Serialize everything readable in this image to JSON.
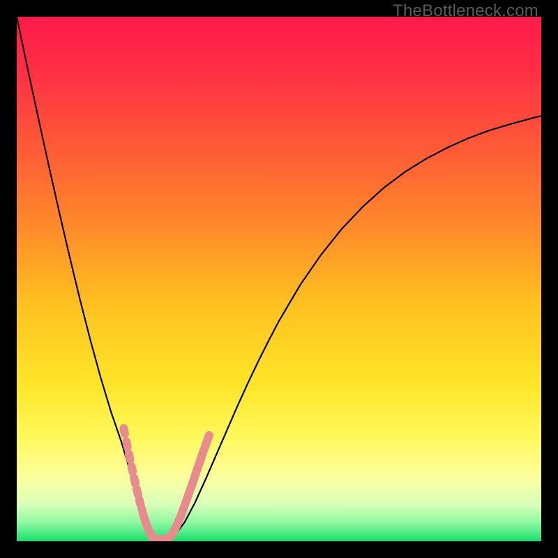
{
  "watermark": "TheBottleneck.com",
  "colors": {
    "gradient_stops": [
      {
        "offset": 0.0,
        "color": "#ff1a4a"
      },
      {
        "offset": 0.1,
        "color": "#ff2e45"
      },
      {
        "offset": 0.25,
        "color": "#ff5a36"
      },
      {
        "offset": 0.4,
        "color": "#ff8a2a"
      },
      {
        "offset": 0.55,
        "color": "#ffc220"
      },
      {
        "offset": 0.7,
        "color": "#ffe528"
      },
      {
        "offset": 0.8,
        "color": "#fff85a"
      },
      {
        "offset": 0.88,
        "color": "#fcffa0"
      },
      {
        "offset": 0.93,
        "color": "#d8ffb8"
      },
      {
        "offset": 0.965,
        "color": "#8cf7a0"
      },
      {
        "offset": 1.0,
        "color": "#18e06a"
      }
    ],
    "curve": "#000000",
    "markers": "#e98b8e",
    "frame": "#000000"
  },
  "chart_data": {
    "type": "line",
    "title": "",
    "xlabel": "",
    "ylabel": "",
    "xlim": [
      0,
      100
    ],
    "ylim": [
      0,
      100
    ],
    "grid": false,
    "legend": false,
    "x": [
      0,
      2,
      4,
      6,
      8,
      10,
      12,
      14,
      16,
      18,
      20,
      22,
      23,
      24,
      25,
      26,
      27,
      28,
      30,
      32,
      34,
      36,
      38,
      40,
      42,
      44,
      46,
      48,
      50,
      54,
      58,
      62,
      66,
      70,
      74,
      78,
      82,
      86,
      90,
      94,
      98,
      100
    ],
    "values": [
      100,
      90.5,
      81.2,
      72.1,
      63.2,
      54.6,
      46.3,
      38.5,
      31.2,
      24.6,
      18.8,
      12.0,
      8.6,
      5.6,
      3.0,
      1.2,
      0.2,
      0.0,
      1.0,
      3.6,
      7.4,
      11.8,
      16.4,
      21.0,
      25.6,
      30.0,
      34.2,
      38.2,
      42.0,
      48.8,
      54.6,
      59.6,
      63.8,
      67.4,
      70.4,
      72.9,
      75.0,
      76.8,
      78.3,
      79.5,
      80.6,
      81.1
    ],
    "markers_left": [
      {
        "x": 20.5,
        "y": 21.0
      },
      {
        "x": 21.0,
        "y": 18.5
      },
      {
        "x": 21.5,
        "y": 16.1
      },
      {
        "x": 22.0,
        "y": 13.8
      },
      {
        "x": 22.5,
        "y": 11.5
      },
      {
        "x": 23.0,
        "y": 9.4
      },
      {
        "x": 23.5,
        "y": 7.4
      },
      {
        "x": 24.0,
        "y": 5.6
      },
      {
        "x": 24.5,
        "y": 3.9
      },
      {
        "x": 25.0,
        "y": 2.5
      },
      {
        "x": 25.5,
        "y": 1.4
      },
      {
        "x": 26.0,
        "y": 0.6
      }
    ],
    "markers_right": [
      {
        "x": 29.0,
        "y": 0.6
      },
      {
        "x": 29.5,
        "y": 1.2
      },
      {
        "x": 30.0,
        "y": 2.0
      },
      {
        "x": 30.5,
        "y": 3.0
      },
      {
        "x": 31.0,
        "y": 4.2
      },
      {
        "x": 31.5,
        "y": 5.4
      },
      {
        "x": 32.0,
        "y": 6.8
      },
      {
        "x": 32.5,
        "y": 8.2
      },
      {
        "x": 33.0,
        "y": 9.6
      },
      {
        "x": 33.5,
        "y": 11.0
      },
      {
        "x": 34.0,
        "y": 12.5
      },
      {
        "x": 34.5,
        "y": 14.0
      },
      {
        "x": 35.0,
        "y": 15.4
      },
      {
        "x": 35.5,
        "y": 16.9
      },
      {
        "x": 36.0,
        "y": 18.3
      },
      {
        "x": 36.5,
        "y": 19.7
      }
    ],
    "markers_floor": [
      {
        "x": 26.5,
        "y": 0.1
      },
      {
        "x": 27.0,
        "y": 0.0
      },
      {
        "x": 27.5,
        "y": 0.0
      },
      {
        "x": 28.0,
        "y": 0.0
      },
      {
        "x": 28.5,
        "y": 0.2
      }
    ]
  }
}
